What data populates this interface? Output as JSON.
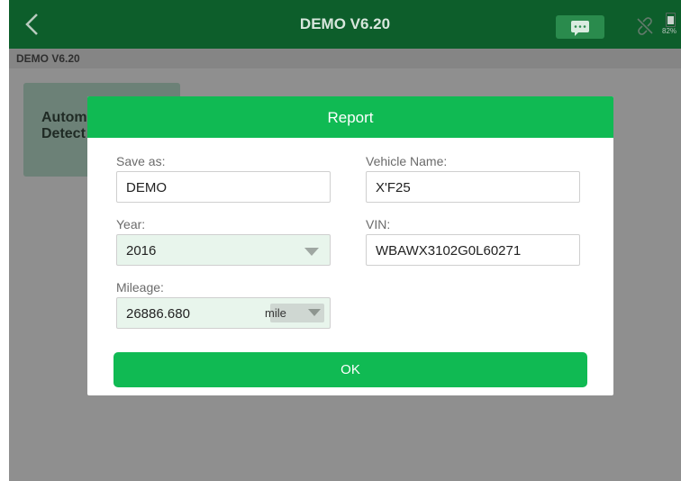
{
  "header": {
    "title": "DEMO V6.20",
    "battery_percent": "82%"
  },
  "breadcrumb": {
    "text": "DEMO V6.20"
  },
  "tile": {
    "label_line1": "Autom",
    "label_line2": "Detect"
  },
  "dialog": {
    "title": "Report",
    "save_as": {
      "label": "Save as:",
      "value": "DEMO"
    },
    "vehicle_name": {
      "label": "Vehicle Name:",
      "value": "X'F25"
    },
    "year": {
      "label": "Year:",
      "value": "2016"
    },
    "vin": {
      "label": "VIN:",
      "value": "WBAWX3102G0L60271"
    },
    "mileage": {
      "label": "Mileage:",
      "value": "26886.680",
      "unit": "mile"
    },
    "ok_label": "OK"
  },
  "colors": {
    "header_bg": "#0d5e2b",
    "accent_green": "#10ba53",
    "overlay_gray": "#8f8f8f"
  },
  "icons": [
    "back-chevron-icon",
    "message-icon",
    "link-broken-icon",
    "battery-icon",
    "dropdown-arrow-icon"
  ]
}
